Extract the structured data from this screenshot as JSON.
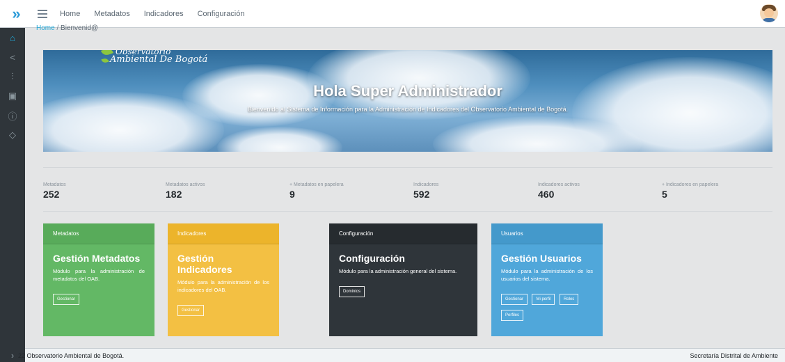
{
  "header": {
    "nav": [
      "Home",
      "Metadatos",
      "Indicadores",
      "Configuración"
    ]
  },
  "sidebar": {
    "icons": [
      "home-icon",
      "share-icon",
      "sliders-icon",
      "clipboard-icon",
      "info-icon",
      "tag-icon"
    ]
  },
  "breadcrumb": {
    "home": "Home",
    "separator": "/",
    "current": "Bienvenid@"
  },
  "hero": {
    "logo_line1": "Observatorio",
    "logo_line2": "Ambiental De Bogotá",
    "title": "Hola Super Administrador",
    "subtitle": "Bienvenido al Sistema de Información para la Administración de Indicadores del Observatorio Ambiental de Bogotá."
  },
  "stats": [
    {
      "label": "Metadatos",
      "value": "252"
    },
    {
      "label": "Metadatos activos",
      "value": "182"
    },
    {
      "label": "+ Metadatos en papelera",
      "value": "9"
    },
    {
      "label": "Indicadores",
      "value": "592"
    },
    {
      "label": "Indicadores activos",
      "value": "460"
    },
    {
      "label": "+ Indicadores en papelera",
      "value": "5"
    }
  ],
  "cards": {
    "metadatos": {
      "header": "Metadatos",
      "title": "Gestión Metadatos",
      "desc": "Módulo para la administración de metadatos del OAB.",
      "buttons": [
        "Gestionar"
      ]
    },
    "indicadores": {
      "header": "Indicadores",
      "title": "Gestión Indicadores",
      "desc": "Módulo para la administración de los indicadores del OAB.",
      "buttons": [
        "Gestionar"
      ]
    },
    "configuracion": {
      "header": "Configuración",
      "title": "Configuración",
      "desc": "Módulo para la administración general del sistema.",
      "buttons": [
        "Dominios"
      ]
    },
    "usuarios": {
      "header": "Usuarios",
      "title": "Gestión Usuarios",
      "desc": "Módulo para la administración de los usuarios del sistema.",
      "buttons": [
        "Gestionar",
        "Mi perfil",
        "Roles",
        "Perfiles"
      ]
    }
  },
  "colors": {
    "green": "#63b865",
    "yellow": "#f3c043",
    "dark": "#2f353a",
    "blue": "#50a7da",
    "accent": "#20a8d8"
  },
  "footer": {
    "left": "22 Observatorio Ambiental de Bogotá.",
    "right": "Secretaría Distrital de Ambiente"
  }
}
